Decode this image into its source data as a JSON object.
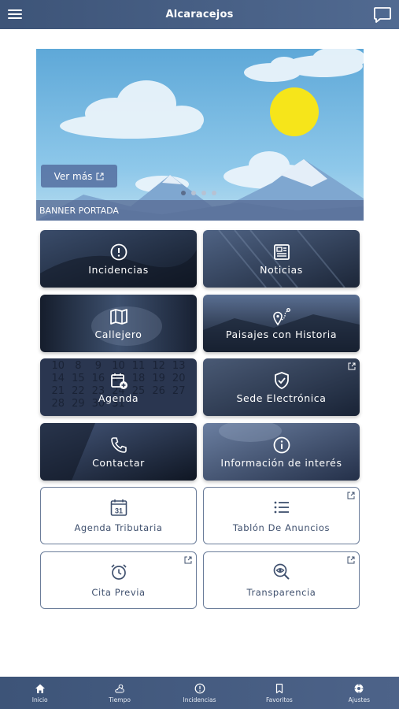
{
  "header": {
    "title": "Alcaracejos"
  },
  "banner": {
    "button_label": "Ver más",
    "caption": "BANNER PORTADA",
    "slides": 4,
    "active_slide": 1
  },
  "tiles": {
    "incidencias": "Incidencias",
    "noticias": "Noticias",
    "callejero": "Callejero",
    "paisajes": "Paisajes con Historia",
    "agenda": "Agenda",
    "sede": "Sede Electrónica",
    "contactar": "Contactar",
    "informacion": "Información de interés",
    "agenda_tributaria": "Agenda Tributaria",
    "calendar_day": "31",
    "tablon": "Tablón De Anuncios",
    "cita_previa": "Cita Previa",
    "transparencia": "Transparencia"
  },
  "agenda_bg_numbers": [
    "10",
    "8",
    "9",
    "10",
    "11",
    "12",
    "13",
    "14",
    "15",
    "16",
    "17",
    "18",
    "19",
    "20",
    "21",
    "22",
    "23",
    "24",
    "25",
    "26",
    "27",
    "28",
    "29",
    "30",
    "31"
  ],
  "bottom_nav": [
    {
      "label": "Inicio",
      "icon": "home-icon"
    },
    {
      "label": "Tiempo",
      "icon": "weather-icon"
    },
    {
      "label": "Incidencias",
      "icon": "alert-icon"
    },
    {
      "label": "Favoritos",
      "icon": "bookmark-icon"
    },
    {
      "label": "Ajustes",
      "icon": "settings-icon"
    }
  ],
  "colors": {
    "header": "#3d5478",
    "tile_dark": "#1f2a3e",
    "tile_border": "#6b7d9a",
    "text_dark": "#3f506e"
  }
}
